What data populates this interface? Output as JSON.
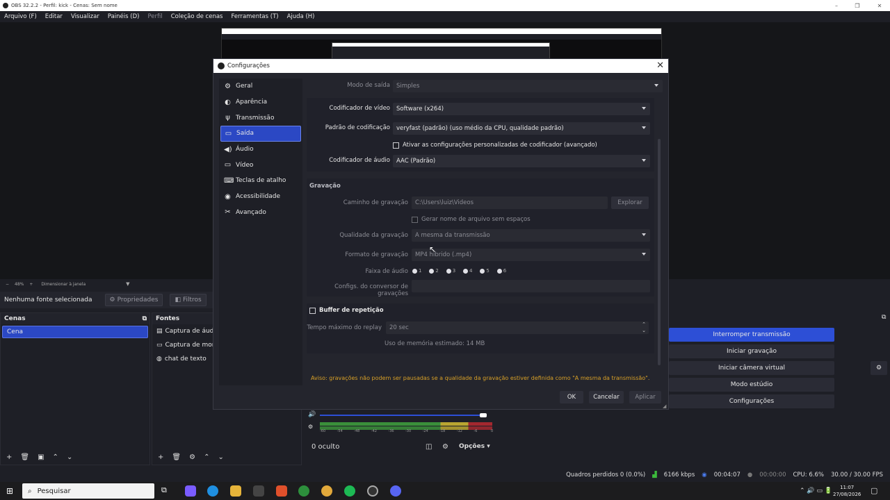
{
  "window": {
    "title": "OBS 32.2.2 - Perfil: kick - Cenas: Sem nome",
    "controls": [
      "–",
      "❐",
      "✕"
    ]
  },
  "menu": {
    "items": [
      "Arquivo (F)",
      "Editar",
      "Visualizar",
      "Painéis (D)",
      "Perfil",
      "Coleção de cenas",
      "Ferramentas (T)",
      "Ajuda (H)"
    ]
  },
  "preview": {
    "zoom": "48%",
    "resize_label": "Dimensionar à janela"
  },
  "source_bar": {
    "no_source": "Nenhuma fonte selecionada",
    "properties": "Propriedades",
    "filters": "Filtros"
  },
  "scenes": {
    "title": "Cenas",
    "items": [
      "Cena"
    ]
  },
  "sources": {
    "title": "Fontes",
    "items": [
      "Captura de áudio",
      "Captura de monitor",
      "chat de texto"
    ]
  },
  "mixer": {
    "hidden_count": "0 oculto",
    "options": "Opções",
    "scale": [
      "-60",
      "-54",
      "-48",
      "-42",
      "-36",
      "-30",
      "-24",
      "-18",
      "-12",
      "-6",
      "0"
    ],
    "volume_fraction": 1.0
  },
  "controls": {
    "stop_stream": "Interromper transmissão",
    "start_recording": "Iniciar gravação",
    "start_virtual_cam": "Iniciar câmera virtual",
    "studio_mode": "Modo estúdio",
    "settings": "Configurações"
  },
  "status": {
    "dropped_frames": "Quadros perdidos 0 (0.0%)",
    "bitrate": "6166 kbps",
    "stream_time": "00:04:07",
    "rec_time": "00:00:00",
    "cpu": "CPU: 6.6%",
    "fps": "30.00 / 30.00 FPS"
  },
  "taskbar": {
    "search_placeholder": "Pesquisar",
    "time": "11:07",
    "date": "27/08/2026"
  },
  "dialog": {
    "title": "Configurações",
    "nav": [
      {
        "label": "Geral",
        "icon": "gear-icon"
      },
      {
        "label": "Aparência",
        "icon": "palette-icon"
      },
      {
        "label": "Transmissão",
        "icon": "antenna-icon"
      },
      {
        "label": "Saída",
        "icon": "output-icon"
      },
      {
        "label": "Áudio",
        "icon": "speaker-icon"
      },
      {
        "label": "Vídeo",
        "icon": "monitor-icon"
      },
      {
        "label": "Teclas de atalho",
        "icon": "keyboard-icon"
      },
      {
        "label": "Acessibilidade",
        "icon": "accessibility-icon"
      },
      {
        "label": "Avançado",
        "icon": "tools-icon"
      }
    ],
    "output_mode_label": "Modo de saída",
    "output_mode_value": "Simples",
    "video_encoder_label": "Codificador de vídeo",
    "video_encoder_value": "Software (x264)",
    "preset_label": "Padrão de codificação",
    "preset_value": "veryfast (padrão) (uso médio da CPU, qualidade padrão)",
    "custom_encoder_check": "Ativar as configurações personalizadas de codificador (avançado)",
    "audio_encoder_label": "Codificador de áudio",
    "audio_encoder_value": "AAC (Padrão)",
    "recording": {
      "title": "Gravação",
      "path_label": "Caminho de gravação",
      "path_value": "C:\\Users\\luiz\\Videos",
      "browse": "Explorar",
      "no_spaces": "Gerar nome de arquivo sem espaços",
      "quality_label": "Qualidade da gravação",
      "quality_value": "A mesma da transmissão",
      "format_label": "Formato de gravação",
      "format_value": "MP4 híbrido (.mp4)",
      "tracks_label": "Faixa de áudio",
      "tracks": [
        "1",
        "2",
        "3",
        "4",
        "5",
        "6"
      ],
      "remux_label": "Configs. do conversor de gravações"
    },
    "replay": {
      "title": "Buffer de repetição",
      "max_time_label": "Tempo máximo do replay",
      "max_time_value": "20 sec",
      "memory": "Uso de memória estimado: 14 MB"
    },
    "warning": "Aviso: gravações não podem ser pausadas se a qualidade da gravação estiver definida como \"A mesma da transmissão\".",
    "ok": "OK",
    "cancel": "Cancelar",
    "apply": "Aplicar"
  }
}
